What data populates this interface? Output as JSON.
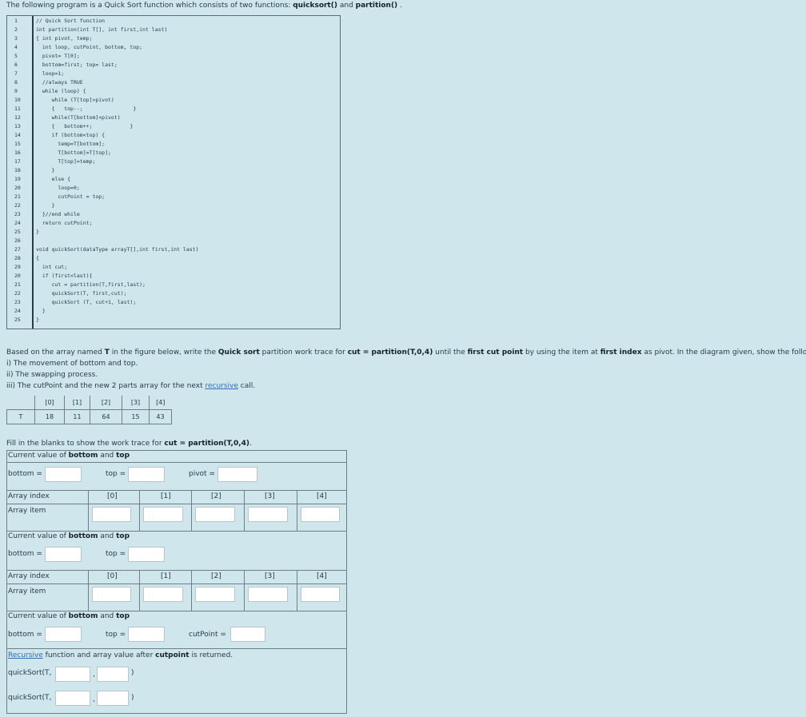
{
  "intro": {
    "prefix": "The following program is a Quick Sort function which consists of two functions: ",
    "fn1": "quicksort()",
    "and": " and ",
    "fn2": "partition()",
    "suffix": " ."
  },
  "code": {
    "line_numbers": [
      "1",
      "2",
      "3",
      "4",
      "5",
      "6",
      "7",
      "8",
      "9",
      "10",
      "11",
      "12",
      "13",
      "14",
      "15",
      "16",
      "17",
      "18",
      "19",
      "20",
      "21",
      "22",
      "23",
      "24",
      "25",
      "26",
      "27",
      "28",
      "29",
      "20",
      "21",
      "22",
      "23",
      "24",
      "25"
    ],
    "lines": [
      "// Quick Sort function",
      "int partition(int T[], int first,int last)",
      "{ int pivot, temp;",
      "  int loop, cutPoint, bottom, top;",
      "  pivot= T[0];",
      "  bottom=first; top= last;",
      "  loop=1;",
      "  //always TRUE",
      "  while (loop) {",
      "     while (T[top]>pivot)",
      "     {   top--;                }",
      "     while(T[bottom]<pivot)",
      "     {   bottom++;            }",
      "     if (bottom<top) {",
      "       temp=T[bottom];",
      "       T[bottom]=T[top];",
      "       T[top]=temp;",
      "     }",
      "     else {",
      "       loop=0;",
      "       cutPoint = top;",
      "     }",
      "  }//end while",
      "  return cutPoint;",
      "}",
      "",
      "void quickSort(dataType arrayT[],int first,int last)",
      "{",
      "  int cut;",
      "  if (first<last){",
      "     cut = partition(T,first,last);",
      "     quickSort(T, first,cut);",
      "     quickSort (T, cut+1, last);",
      "  }",
      "}"
    ]
  },
  "question": {
    "p1_a": "Based on the array named ",
    "p1_T": "T",
    "p1_b": " in the figure below, write the ",
    "p1_qs": "Quick sort",
    "p1_c": " partition work trace for ",
    "p1_cut": "cut = partition(T,0,4)",
    "p1_d": " until the ",
    "p1_fcp": "first cut point",
    "p1_e": " by using the item at ",
    "p1_fi": "first index",
    "p1_f": " as pivot. In the diagram given, show the following:",
    "item1": "i)  The movement of bottom and top.",
    "item2": "ii)  The swapping process.",
    "item3_a": "iii) The cutPoint and the new 2 parts array for the next ",
    "item3_link": "recursive",
    "item3_b": " call."
  },
  "array_table": {
    "name": "T",
    "indices": [
      "[0]",
      "[1]",
      "[2]",
      "[3]",
      "[4]"
    ],
    "values": [
      "18",
      "11",
      "64",
      "15",
      "43"
    ]
  },
  "form": {
    "instruction_a": "Fill in the blanks to show the work trace for ",
    "instruction_b": "cut = partition(T,0,4)",
    "instruction_c": ".",
    "current_a": "Current value of ",
    "current_bottom": "bottom",
    "current_and": " and ",
    "current_top": "top",
    "bottom_label": "bottom =",
    "top_label": "top =",
    "pivot_label": "pivot =",
    "cutpoint_label": "cutPoint =",
    "array_index_label": "Array index",
    "array_item_label": "Array item",
    "indices": [
      "[0]",
      "[1]",
      "[2]",
      "[3]",
      "[4]"
    ],
    "recursive_link": "Recursive",
    "recursive_a": " function and array value after ",
    "recursive_cp": "cutpoint",
    "recursive_b": " is returned.",
    "call_prefix": "quickSort(T,",
    "call_comma": ",",
    "call_close": ")"
  },
  "colors": {
    "background": "#cfe6ec",
    "link": "#2d6fb7",
    "input_fill": "#ffffff"
  }
}
